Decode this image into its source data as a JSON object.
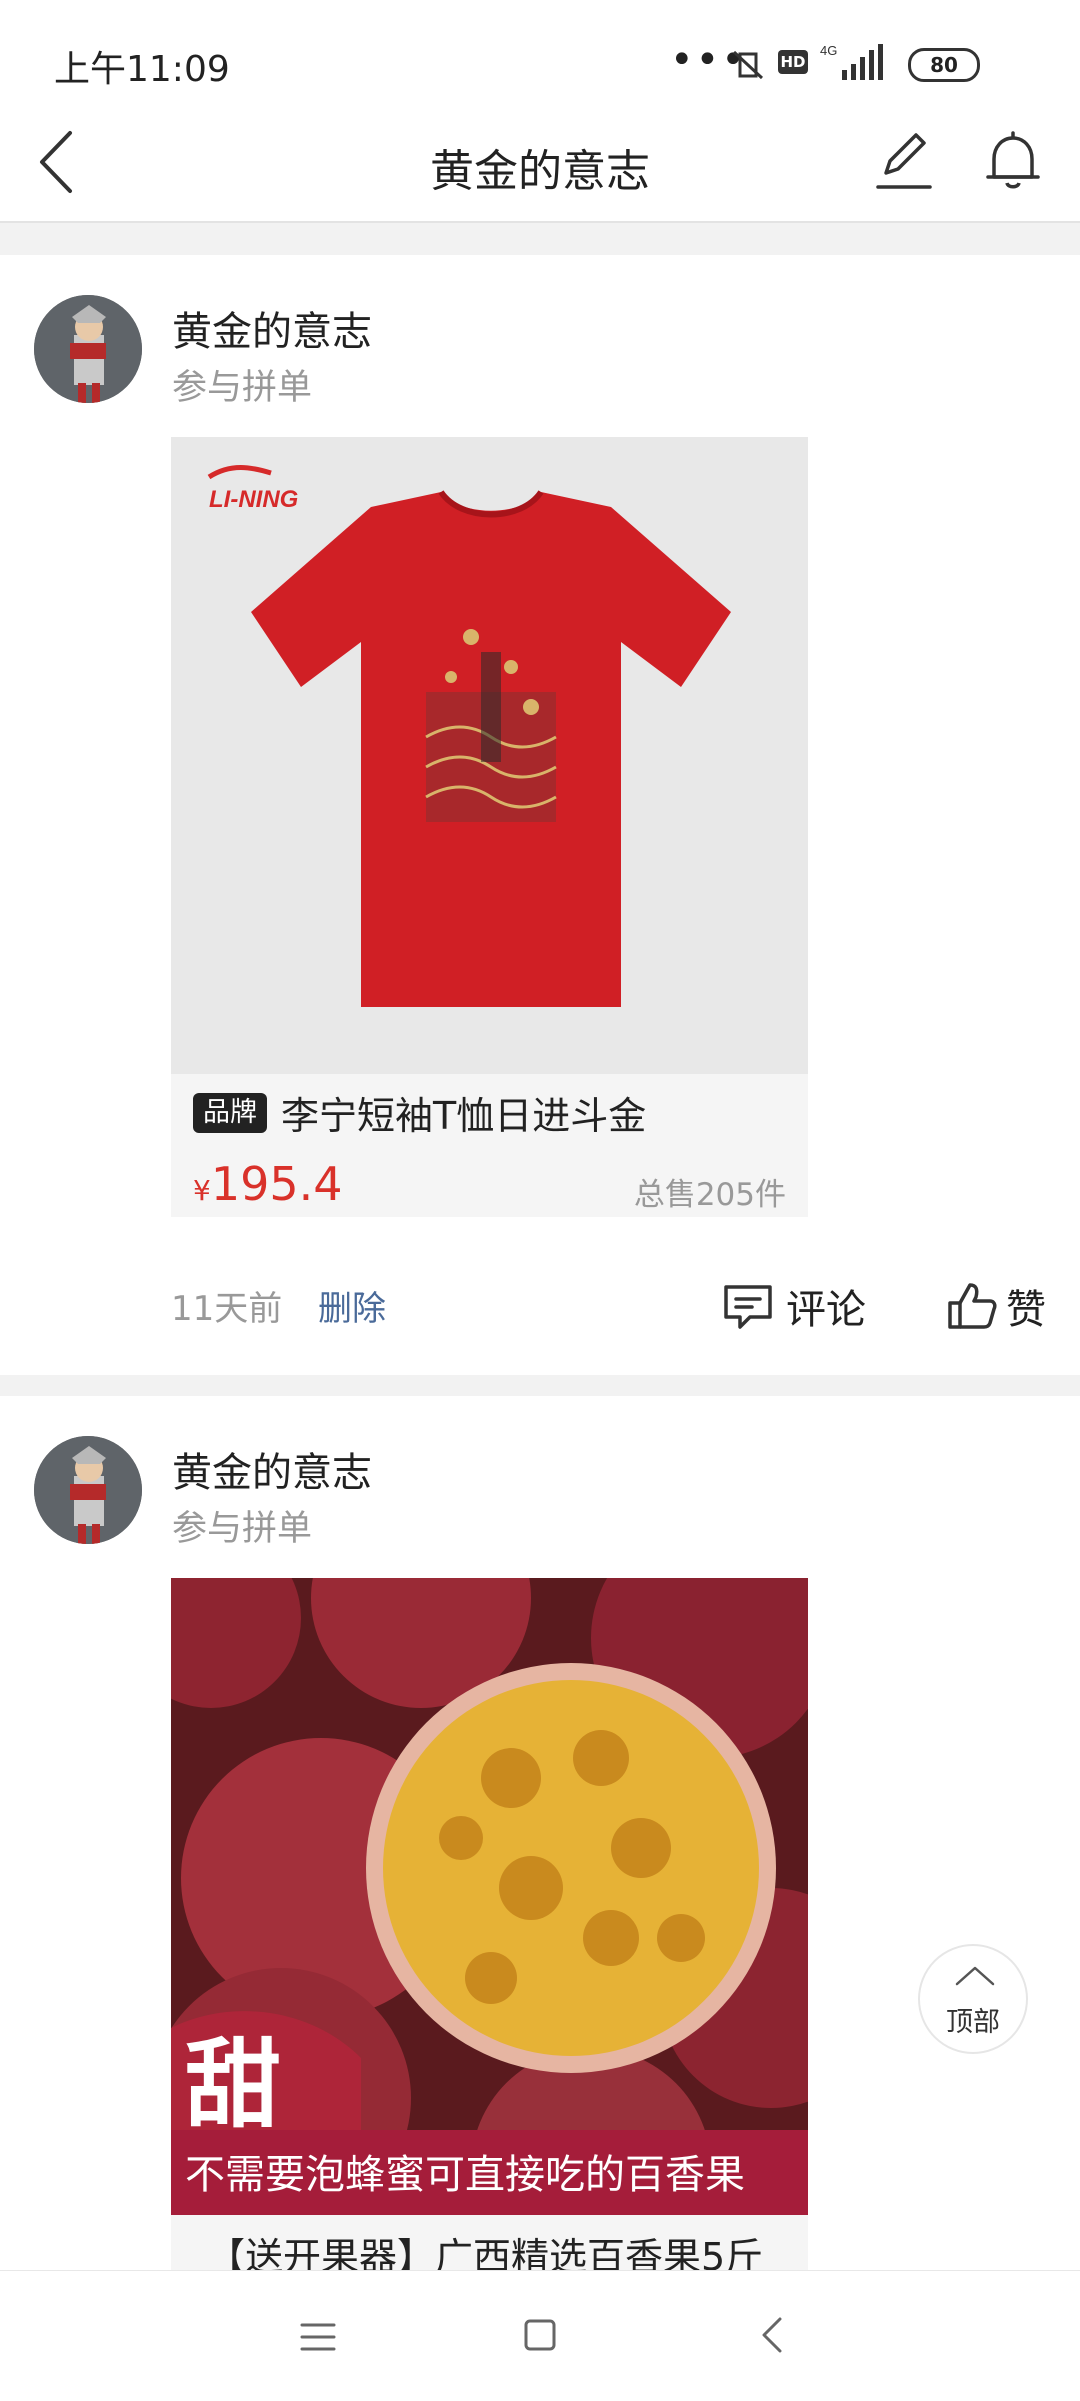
{
  "status_bar": {
    "time": "上午11:09",
    "dots": "•••",
    "hd": "HD",
    "network": "4G",
    "battery": "80"
  },
  "nav": {
    "title": "黄金的意志"
  },
  "posts": [
    {
      "username": "黄金的意志",
      "subtitle": "参与拼单",
      "brand_tag": "品牌",
      "item_title": "李宁短袖T恤日进斗金",
      "price_currency": "¥",
      "price": "195.4",
      "sold": "总售205件",
      "image_logo": "LI-NING",
      "time": "11天前",
      "delete_label": "删除",
      "comment_label": "评论",
      "like_label": "赞"
    },
    {
      "username": "黄金的意志",
      "subtitle": "参与拼单",
      "image_big_text": "甜",
      "image_banner": "不需要泡蜂蜜可直接吃的百香果",
      "item_title": "【送开果器】广西精选百香果5斤"
    }
  ],
  "top_button": {
    "label": "顶部"
  },
  "colors": {
    "price_red": "#d9312a",
    "link_blue": "#4a6a99",
    "shirt_red": "#d01f25"
  }
}
